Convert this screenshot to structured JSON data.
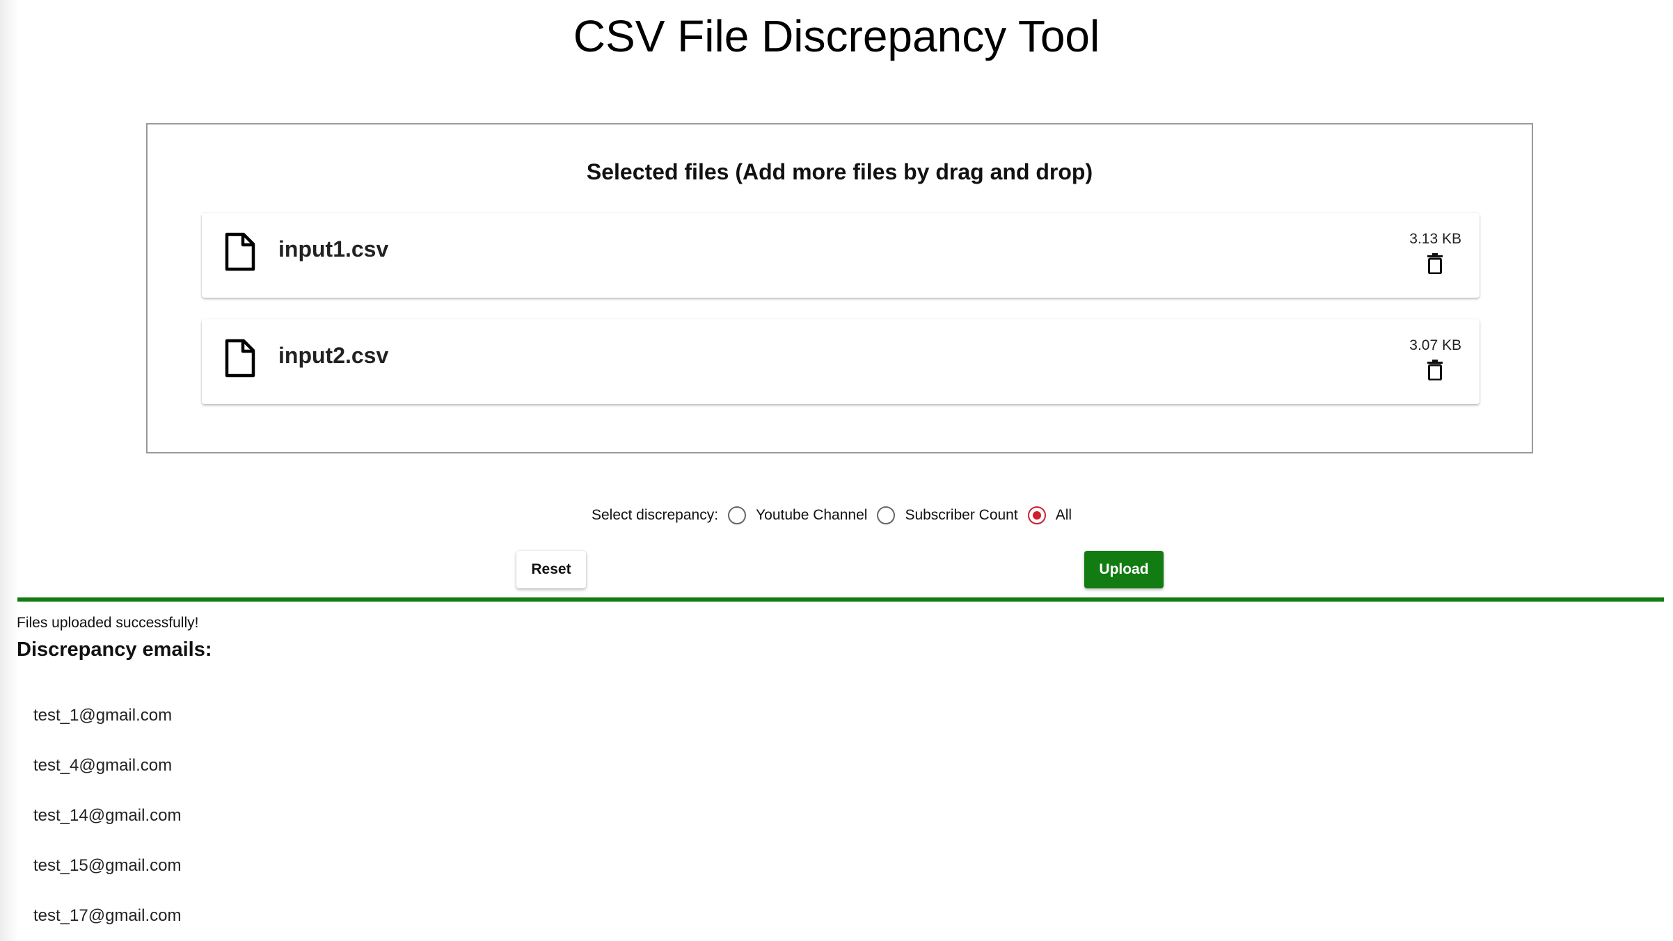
{
  "header": {
    "title": "CSV File Discrepancy Tool"
  },
  "dropzone": {
    "heading": "Selected files (Add more files by drag and drop)",
    "files": [
      {
        "name": "input1.csv",
        "size": "3.13 KB",
        "icon": "file-icon",
        "delete_icon": "trash-icon"
      },
      {
        "name": "input2.csv",
        "size": "3.07 KB",
        "icon": "file-icon",
        "delete_icon": "trash-icon"
      }
    ]
  },
  "discrepancy": {
    "label": "Select discrepancy:",
    "options": [
      {
        "label": "Youtube Channel",
        "checked": false
      },
      {
        "label": "Subscriber Count",
        "checked": false
      },
      {
        "label": "All",
        "checked": true
      }
    ],
    "accent_color": "#d01e2d"
  },
  "actions": {
    "reset_label": "Reset",
    "upload_label": "Upload",
    "upload_color": "#127c12"
  },
  "progress": {
    "value_percent": 100,
    "color": "#127c12"
  },
  "result": {
    "status": "Files uploaded successfully!",
    "heading": "Discrepancy emails:",
    "emails": [
      "test_1@gmail.com",
      "test_4@gmail.com",
      "test_14@gmail.com",
      "test_15@gmail.com",
      "test_17@gmail.com"
    ]
  }
}
